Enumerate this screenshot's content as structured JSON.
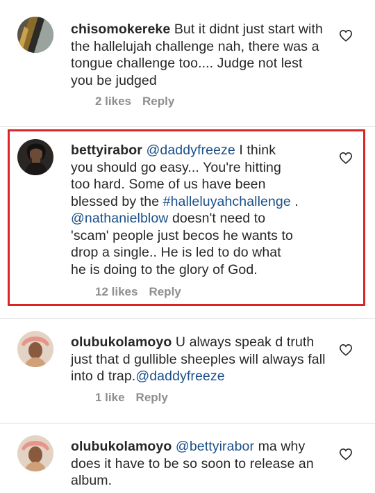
{
  "comments": [
    {
      "username": "chisomokereke",
      "text": " But it didnt just start with the hallelujah challenge nah, there was a tongue challenge too.... Judge not lest you be judged",
      "likes": "2 likes",
      "reply": "Reply"
    },
    {
      "username": "bettyirabor",
      "mention1": "@daddyfreeze",
      "text1": " I think you should go easy... You're hitting too hard. Some of us have been blessed by the ",
      "hashtag": "#halleluyahchallenge",
      "text2": " . ",
      "mention2": "@nathanielblow",
      "text3": " doesn't need to 'scam' people just becos he wants to drop a single.. He is led to do what he is doing to the glory of God.",
      "likes": "12 likes",
      "reply": "Reply"
    },
    {
      "username": "olubukolamoyo",
      "text": " U always speak d truth just that d gullible sheeples will always fall into d trap.",
      "mention": "@daddyfreeze",
      "likes": "1 like",
      "reply": "Reply"
    },
    {
      "username": "olubukolamoyo",
      "mention": "@bettyirabor",
      "text": "  ma why does it have to be so soon to release an album."
    }
  ],
  "icons": {
    "like": "heart-outline-icon"
  },
  "colors": {
    "highlight": "#d9252a",
    "mention": "#1a4f8a",
    "meta": "#8e8e8e"
  }
}
